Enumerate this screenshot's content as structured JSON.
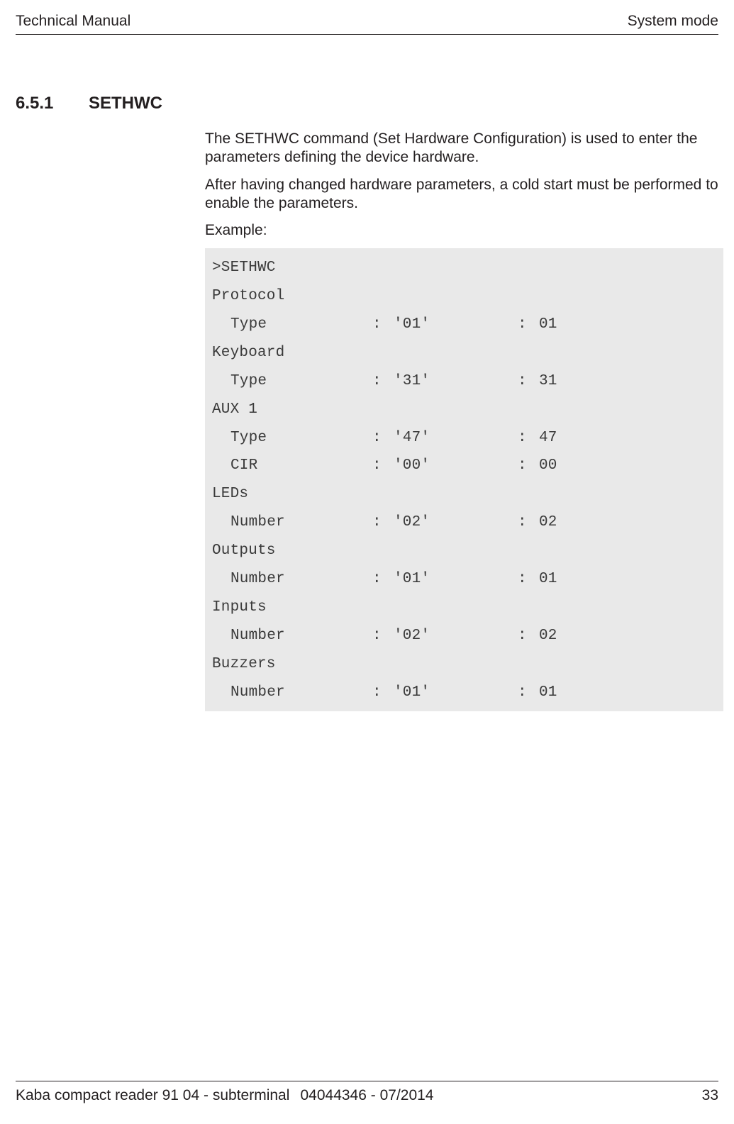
{
  "header": {
    "left": "Technical Manual",
    "right": "System mode"
  },
  "heading": {
    "number": "6.5.1",
    "title": "SETHWC"
  },
  "paragraphs": {
    "p1": "The SETHWC command (Set Hardware Configuration) is used to enter the parameters defining the device hardware.",
    "p2": "After having changed hardware parameters, a cold start must be performed to enable the parameters.",
    "p3": "Example:"
  },
  "code": {
    "prompt": ">SETHWC",
    "sections": [
      {
        "title": "Protocol",
        "rows": [
          {
            "label": "Type",
            "v1": "'01'",
            "v2": "01"
          }
        ]
      },
      {
        "title": "Keyboard",
        "rows": [
          {
            "label": "Type",
            "v1": "'31'",
            "v2": "31"
          }
        ]
      },
      {
        "title": "AUX 1",
        "rows": [
          {
            "label": "Type",
            "v1": "'47'",
            "v2": "47"
          },
          {
            "label": "CIR",
            "v1": "'00'",
            "v2": "00"
          }
        ]
      },
      {
        "title": "LEDs",
        "rows": [
          {
            "label": "Number",
            "v1": "'02'",
            "v2": "02"
          }
        ]
      },
      {
        "title": "Outputs",
        "rows": [
          {
            "label": "Number",
            "v1": "'01'",
            "v2": "01"
          }
        ]
      },
      {
        "title": "Inputs",
        "rows": [
          {
            "label": "Number",
            "v1": "'02'",
            "v2": "02"
          }
        ]
      },
      {
        "title": "Buzzers",
        "rows": [
          {
            "label": "Number",
            "v1": "'01'",
            "v2": "01"
          }
        ]
      }
    ]
  },
  "footer": {
    "left": "Kaba compact reader 91 04 - subterminal",
    "center": "04044346 - 07/2014",
    "right": "33"
  }
}
